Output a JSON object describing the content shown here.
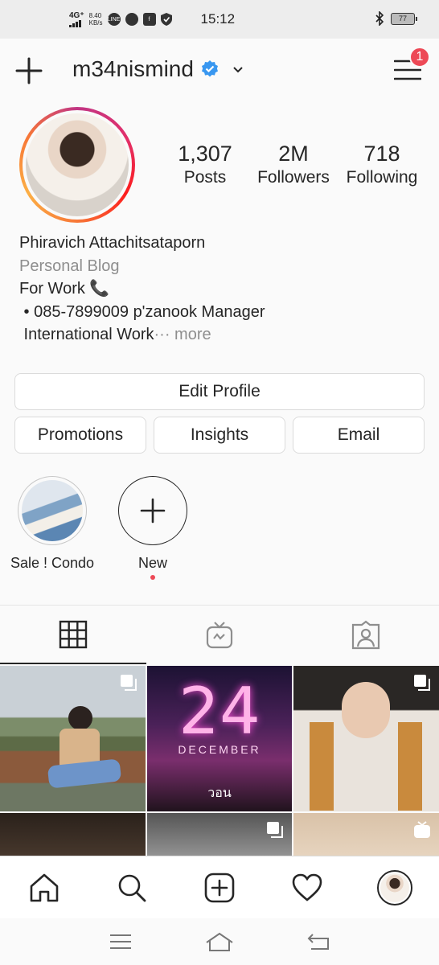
{
  "status_bar": {
    "network": "4G⁺",
    "speed": "8.40",
    "speed_unit": "KB/s",
    "line_icon": "LINE",
    "time": "15:12",
    "battery": "77",
    "icons": [
      "line-icon",
      "chat-icon",
      "facebook-icon",
      "shield-icon",
      "bluetooth-icon",
      "battery-icon"
    ]
  },
  "header": {
    "username": "m34nismind",
    "verified": true,
    "notification_count": "1"
  },
  "stats": [
    {
      "value": "1,307",
      "label": "Posts"
    },
    {
      "value": "2M",
      "label": "Followers"
    },
    {
      "value": "718",
      "label": "Following"
    }
  ],
  "bio": {
    "name": "Phiravich Attachitsataporn",
    "category": "Personal Blog",
    "line1": "For Work 📞",
    "line2": " • 085-7899009 p'zanook Manager",
    "line3": " International Work",
    "more": "··· more"
  },
  "buttons": {
    "edit_profile": "Edit Profile",
    "promotions": "Promotions",
    "insights": "Insights",
    "email": "Email"
  },
  "highlights": [
    {
      "label": "Sale ! Condo"
    },
    {
      "label": "New"
    }
  ],
  "tabs": [
    "grid-icon",
    "igtv-icon",
    "tagged-icon"
  ],
  "grid_posts": [
    {
      "id": "post-1",
      "multi": true
    },
    {
      "id": "post-2",
      "title": "24",
      "subtitle": "DECEMBER",
      "brand": "วอน",
      "multi": false
    },
    {
      "id": "post-3",
      "multi": true
    },
    {
      "id": "post-4",
      "multi": false
    },
    {
      "id": "post-5",
      "multi": true
    },
    {
      "id": "post-6",
      "igtv": true
    }
  ],
  "colors": {
    "accent": "#3897f0",
    "notification": "#ed4956",
    "text": "#262626",
    "secondary": "#8e8e8e"
  }
}
